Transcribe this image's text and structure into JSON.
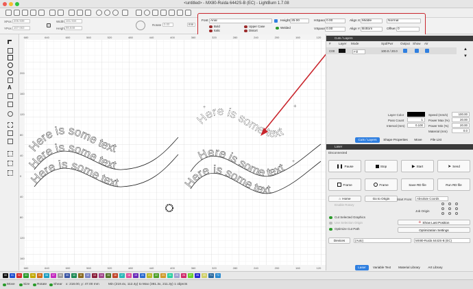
{
  "window": {
    "title": "<untitled> - MX80-Ruida 6442S-B (EC) - LightBurn 1.7.08"
  },
  "propbar": {
    "xpos_label": "XPos",
    "xpos_value": "206.939",
    "ypos_label": "YPos",
    "ypos_value": "167.663",
    "width_label": "Width",
    "width_value": "161.934",
    "height_label": "Height",
    "height_value": "98.848",
    "rotate_label": "Rotate",
    "rotate_value": "0.00",
    "units": "mm"
  },
  "textbar": {
    "font_label": "Font",
    "font_value": "Arial",
    "height_label": "Height",
    "height_value": "25.00",
    "hspace_label": "HSpace",
    "hspace_value": "0.00",
    "vspace_label": "VSpace",
    "vspace_value": "0.00",
    "alignx_label": "Align X",
    "alignx_value": "Middle",
    "aligny_label": "Align Y",
    "aligny_value": "Bottom",
    "mode_value": "Normal",
    "offset_label": "Offset",
    "offset_value": "0",
    "bold_label": "Bold",
    "italic_label": "Italic",
    "upper_label": "Upper Case",
    "distort_label": "Distort",
    "welded_label": "Welded"
  },
  "canvas": {
    "curve_text": "Here is some text",
    "top_ruler": [
      "680",
      "640",
      "600",
      "560",
      "520",
      "480",
      "440",
      "400",
      "360",
      "320",
      "280",
      "240",
      "200",
      "160",
      "120"
    ],
    "left_ruler": [
      "200",
      "160",
      "120",
      "80",
      "40",
      "0",
      "40",
      "80",
      "120",
      "160",
      "200"
    ],
    "bottom_ruler": [
      "680",
      "640",
      "600",
      "560",
      "520",
      "480",
      "440",
      "400",
      "360",
      "320",
      "280",
      "240",
      "200",
      "160",
      "120"
    ]
  },
  "cuts": {
    "panel_title": "Cuts / Layers",
    "headers": {
      "layer": "#",
      "layer_name": "Layer",
      "mode": "Mode",
      "spdpwr": "Spd/Pwr",
      "output": "Output",
      "show": "Show",
      "air": "Air"
    },
    "row": {
      "num": "C00",
      "mode": "Fill",
      "spdpwr": "100.0 / 20.0"
    },
    "layer_color_label": "Layer Color",
    "pass_count_label": "Pass Count",
    "pass_count_value": "1",
    "interval_label": "Interval (mm)",
    "interval_value": "0.100",
    "speed_label": "Speed (mm/s)",
    "speed_value": "100.00",
    "powermax_label": "Power Max (%)",
    "powermax_value": "20.00",
    "powermin_label": "Power Min (%)",
    "powermin_value": "20.00",
    "material_label": "Material (mm)",
    "material_value": "0.0",
    "tabs": [
      "Cuts / Layers",
      "Shape Properties",
      "Move",
      "File List"
    ]
  },
  "laser": {
    "panel_title": "Laser",
    "status": "Disconnected",
    "buttons": {
      "pause": "Pause",
      "stop": "Stop",
      "start": "Start",
      "send": "Send",
      "frame1": "Frame",
      "frame2": "Frame",
      "save_rd": "Save RD file",
      "run_rd": "Run RD file",
      "home": "Home",
      "goto_origin": "Go to Origin",
      "show_last": "Show Last Position",
      "opt_settings": "Optimization Settings"
    },
    "enable_rotary": "Enable Rotary",
    "start_from_label": "Start From:",
    "start_from_value": "Absolute Coords",
    "job_origin_label": "Job Origin",
    "cut_selected": "Cut Selected Graphics",
    "use_selection_origin": "Use Selection Origin",
    "optimize_cut": "Optimize Cut Path",
    "devices_label": "Devices",
    "devices_value": "(Auto)",
    "device_name": "MX80-Ruida 6442S-B (EC)",
    "tabs": [
      "Laser",
      "Variable Text",
      "Material Library",
      "Art Library"
    ]
  },
  "palette": {
    "swatches": [
      {
        "label": "00",
        "color": "#111111"
      },
      {
        "label": "01",
        "color": "#1f4fd0"
      },
      {
        "label": "02",
        "color": "#d42a2a"
      },
      {
        "label": "03",
        "color": "#2a9a2a"
      },
      {
        "label": "04",
        "color": "#c2a800"
      },
      {
        "label": "05",
        "color": "#d06a18"
      },
      {
        "label": "06",
        "color": "#1e9fc2"
      },
      {
        "label": "07",
        "color": "#c42ac0"
      },
      {
        "label": "08",
        "color": "#9c9c9c"
      },
      {
        "label": "09",
        "color": "#3a55a5"
      },
      {
        "label": "10",
        "color": "#1f8a55"
      },
      {
        "label": "11",
        "color": "#8a6a1f"
      },
      {
        "label": "12",
        "color": "#7a82c2"
      },
      {
        "label": "13",
        "color": "#8a1f3a"
      },
      {
        "label": "14",
        "color": "#a2458a"
      },
      {
        "label": "15",
        "color": "#55752a"
      },
      {
        "label": "16",
        "color": "#c2452a"
      },
      {
        "label": "17",
        "color": "#2ab8b8"
      },
      {
        "label": "18",
        "color": "#e04f9a"
      },
      {
        "label": "19",
        "color": "#6a2ab8"
      },
      {
        "label": "20",
        "color": "#2a6ad0"
      },
      {
        "label": "21",
        "color": "#b8b82a"
      },
      {
        "label": "22",
        "color": "#4fa02a"
      },
      {
        "label": "23",
        "color": "#d09a2a"
      },
      {
        "label": "24",
        "color": "#2ad0a0"
      },
      {
        "label": "25",
        "color": "#a0a0d0"
      },
      {
        "label": "26",
        "color": "#d02a6a"
      },
      {
        "label": "27",
        "color": "#6ad02a"
      },
      {
        "label": "28",
        "color": "#2a2ad0"
      },
      {
        "label": "29",
        "color": "#d0d06a"
      },
      {
        "label": "T1",
        "color": "#2a6aa0"
      },
      {
        "label": "T2",
        "color": "#2a8ad0"
      }
    ]
  },
  "status": {
    "move": "Move",
    "size": "Size",
    "rotate": "Rotate",
    "shear": "Shear",
    "coords": "x: 218.00, y: 47.00 mm",
    "bounds": "Min (219.4x, 112.4y) to Max (381.3x, 211.3y)  1 objects"
  }
}
